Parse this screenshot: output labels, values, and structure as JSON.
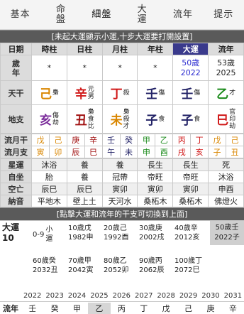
{
  "tabs": [
    {
      "label": "基本"
    },
    {
      "label": "命盤"
    },
    {
      "label": "細盤"
    },
    {
      "label": "大運"
    },
    {
      "label": "流年"
    },
    {
      "label": "提示"
    }
  ],
  "banner_top": "[未起大運顯示小運,十步大運要打開設置]",
  "headers": [
    "日期",
    "時柱",
    "日柱",
    "月柱",
    "年柱",
    "大運",
    "流年"
  ],
  "age_row": {
    "label": "歲\n年",
    "hour": "*",
    "day": "*",
    "month": "*",
    "year": "*",
    "dayun_age": "50歲",
    "dayun_year": "2022",
    "liunian_age": "53歲",
    "liunian_year": "2025"
  },
  "tiangan": {
    "label": "天干",
    "cells": [
      {
        "char": "己",
        "note": "梟",
        "color": "#d98600"
      },
      {
        "char": "辛",
        "note": "元\n男",
        "color": "#d01818"
      },
      {
        "char": "丁",
        "note": "殺",
        "color": "#d01818"
      },
      {
        "char": "壬",
        "note": "傷",
        "color": "#222266"
      },
      {
        "char": "壬",
        "note": "傷",
        "color": "#222266"
      },
      {
        "char": "乙",
        "note": "才",
        "color": "#1a8a1a"
      }
    ]
  },
  "dizhi": {
    "label": "地支",
    "cells": [
      {
        "char": "亥",
        "note": "傷\n劫",
        "color": "#7a2a9a"
      },
      {
        "char": "丑",
        "note": "梟\n食\n比",
        "color": "#a01010"
      },
      {
        "char": "未",
        "note": "梟\n殺\n才",
        "color": "#d98600"
      },
      {
        "char": "子",
        "note": "食",
        "color": "#222266"
      },
      {
        "char": "子",
        "note": "食",
        "color": "#222266"
      },
      {
        "char": "巳",
        "note": "官\n印\n劫",
        "color": "#d01818"
      }
    ]
  },
  "liuyue_gan": {
    "label": "流月干",
    "chars": [
      "戊",
      "己",
      "庚",
      "辛",
      "壬",
      "癸",
      "甲",
      "乙",
      "丙",
      "丁",
      "戊",
      "己"
    ]
  },
  "liuyue_zhi": {
    "label": "流月支",
    "chars": [
      "寅",
      "卯",
      "辰",
      "巳",
      "午",
      "未",
      "申",
      "酉",
      "戌",
      "亥",
      "子",
      "丑"
    ]
  },
  "xingyun": {
    "label": "星運",
    "cells": [
      "沐浴",
      "養",
      "養",
      "長生",
      "長生",
      "死"
    ]
  },
  "zizuo": {
    "label": "自坐",
    "cells": [
      "胎",
      "養",
      "冠帶",
      "帝旺",
      "帝旺",
      "沐浴"
    ]
  },
  "kongwang": {
    "label": "空亡",
    "cells": [
      "辰巳",
      "辰巳",
      "寅卯",
      "寅卯",
      "寅卯",
      "申酉"
    ]
  },
  "nayin": {
    "label": "納音",
    "cells": [
      "平地木",
      "壁上土",
      "天河水",
      "桑柘木",
      "桑柘木",
      "佛燈火"
    ]
  },
  "banner_mid": "[點擊大運和流年的干支可切換到上面]",
  "dayun": {
    "label": "大運",
    "num": "10",
    "cells": [
      {
        "age": "0-9",
        "text": "小\n運"
      },
      {
        "age": "10歲",
        "gz": "戊",
        "year": "1982",
        "gz2": "申"
      },
      {
        "age": "20歲",
        "gz": "己",
        "year": "1992",
        "gz2": "酉"
      },
      {
        "age": "30歲",
        "gz": "庚",
        "year": "2002",
        "gz2": "戌"
      },
      {
        "age": "40歲",
        "gz": "辛",
        "year": "2012",
        "gz2": "亥"
      },
      {
        "age": "60歲",
        "gz": "癸",
        "year": "2032",
        "gz2": "丑"
      },
      {
        "age": "70歲",
        "gz": "甲",
        "year": "2042",
        "gz2": "寅"
      },
      {
        "age": "80歲",
        "gz": "乙",
        "year": "2052",
        "gz2": "卯"
      },
      {
        "age": "90歲",
        "gz": "丙",
        "year": "2062",
        "gz2": "辰"
      },
      {
        "age": "100歲",
        "gz": "丁",
        "year": "2072",
        "gz2": "巳"
      }
    ],
    "current": {
      "line1": "50歲壬",
      "line2": "2022子"
    }
  },
  "liunian": {
    "years": [
      "2022",
      "2023",
      "2024",
      "2025",
      "2026",
      "2027",
      "2028",
      "2029",
      "2030",
      "2031"
    ],
    "label": "流年",
    "gans": [
      "壬",
      "癸",
      "甲",
      "乙",
      "丙",
      "丁",
      "戊",
      "己",
      "庚",
      "辛"
    ]
  }
}
